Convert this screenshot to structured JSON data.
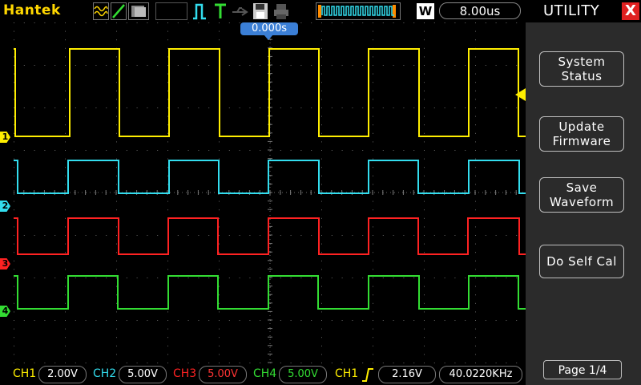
{
  "top_bar": {
    "brand": "Hantek",
    "timebase": "8.00us",
    "trigger_position": "0.000s",
    "window_mode": "W"
  },
  "display": {
    "channel_markers": [
      "1",
      "2",
      "3",
      "4"
    ]
  },
  "bottom_bar": {
    "ch1": {
      "label": "CH1",
      "value": "2.00V",
      "color": "#ffee00"
    },
    "ch2": {
      "label": "CH2",
      "value": "5.00V",
      "color": "#33ddee"
    },
    "ch3": {
      "label": "CH3",
      "value": "5.00V",
      "color": "#ff2222"
    },
    "ch4": {
      "label": "CH4",
      "value": "5.00V",
      "color": "#33dd33"
    },
    "trigger": {
      "source": "CH1",
      "level": "2.16V",
      "frequency": "40.0220KHz"
    }
  },
  "panel": {
    "title": "UTILITY",
    "close": "X",
    "buttons": [
      "System\nStatus",
      "Update\nFirmware",
      "Save\nWaveform",
      "Do Self Cal"
    ],
    "page": "Page 1/4"
  },
  "colors": {
    "ch1": "#ffee00",
    "ch2": "#33ddee",
    "ch3": "#ff2222",
    "ch4": "#33dd33",
    "brand": "#ffd700",
    "close": "#e02020",
    "timebase_marker": "#3b7fd6"
  }
}
